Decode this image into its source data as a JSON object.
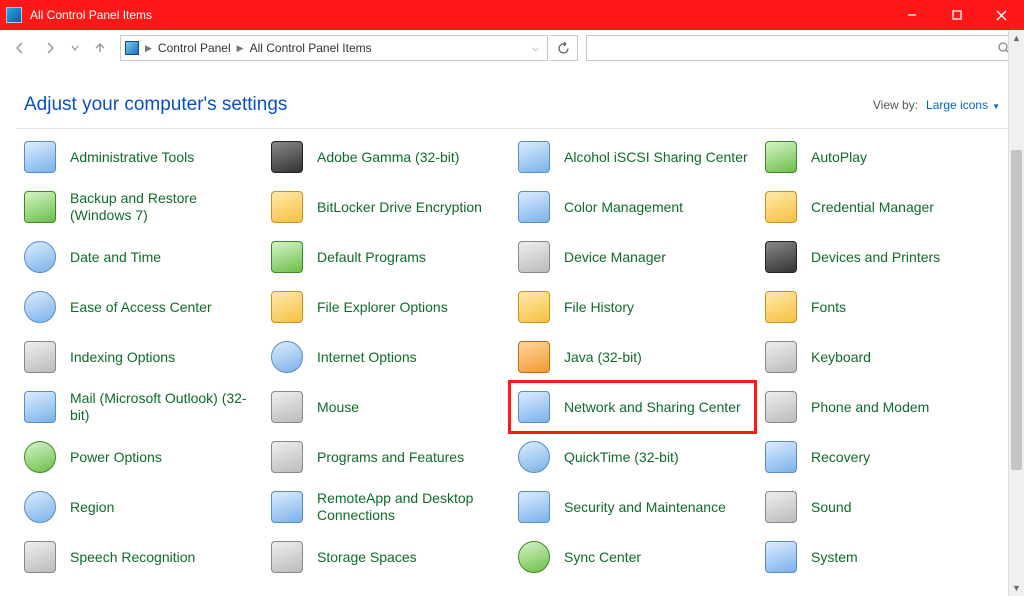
{
  "window": {
    "title": "All Control Panel Items"
  },
  "breadcrumb": {
    "root": "Control Panel",
    "current": "All Control Panel Items"
  },
  "search": {
    "placeholder": ""
  },
  "header": {
    "heading": "Adjust your computer's settings",
    "viewby_label": "View by:",
    "viewby_value": "Large icons"
  },
  "items": [
    {
      "label": "Administrative Tools",
      "icon": "admin-tools",
      "style": "blue"
    },
    {
      "label": "Adobe Gamma (32-bit)",
      "icon": "adobe-gamma",
      "style": "dark"
    },
    {
      "label": "Alcohol iSCSI Sharing Center",
      "icon": "alcohol-iscsi",
      "style": "blue"
    },
    {
      "label": "AutoPlay",
      "icon": "autoplay",
      "style": "green"
    },
    {
      "label": "Backup and Restore (Windows 7)",
      "icon": "backup-restore",
      "style": "green"
    },
    {
      "label": "BitLocker Drive Encryption",
      "icon": "bitlocker",
      "style": "gold"
    },
    {
      "label": "Color Management",
      "icon": "color-mgmt",
      "style": "blue"
    },
    {
      "label": "Credential Manager",
      "icon": "credential-mgr",
      "style": "gold"
    },
    {
      "label": "Date and Time",
      "icon": "date-time",
      "style": "blue"
    },
    {
      "label": "Default Programs",
      "icon": "default-programs",
      "style": "green"
    },
    {
      "label": "Device Manager",
      "icon": "device-manager",
      "style": "gray"
    },
    {
      "label": "Devices and Printers",
      "icon": "devices-printers",
      "style": "dark"
    },
    {
      "label": "Ease of Access Center",
      "icon": "ease-access",
      "style": "blue"
    },
    {
      "label": "File Explorer Options",
      "icon": "file-explorer-opts",
      "style": "gold"
    },
    {
      "label": "File History",
      "icon": "file-history",
      "style": "gold"
    },
    {
      "label": "Fonts",
      "icon": "fonts",
      "style": "gold"
    },
    {
      "label": "Indexing Options",
      "icon": "indexing",
      "style": "gray"
    },
    {
      "label": "Internet Options",
      "icon": "internet-opts",
      "style": "blue"
    },
    {
      "label": "Java (32-bit)",
      "icon": "java",
      "style": "orange"
    },
    {
      "label": "Keyboard",
      "icon": "keyboard",
      "style": "gray"
    },
    {
      "label": "Mail (Microsoft Outlook) (32-bit)",
      "icon": "mail",
      "style": "blue"
    },
    {
      "label": "Mouse",
      "icon": "mouse",
      "style": "gray"
    },
    {
      "label": "Network and Sharing Center",
      "icon": "network-sharing",
      "style": "blue",
      "highlight": true
    },
    {
      "label": "Phone and Modem",
      "icon": "phone-modem",
      "style": "gray"
    },
    {
      "label": "Power Options",
      "icon": "power-opts",
      "style": "green"
    },
    {
      "label": "Programs and Features",
      "icon": "programs-features",
      "style": "gray"
    },
    {
      "label": "QuickTime (32-bit)",
      "icon": "quicktime",
      "style": "blue"
    },
    {
      "label": "Recovery",
      "icon": "recovery",
      "style": "blue"
    },
    {
      "label": "Region",
      "icon": "region",
      "style": "blue"
    },
    {
      "label": "RemoteApp and Desktop Connections",
      "icon": "remoteapp",
      "style": "blue"
    },
    {
      "label": "Security and Maintenance",
      "icon": "security-maint",
      "style": "blue"
    },
    {
      "label": "Sound",
      "icon": "sound",
      "style": "gray"
    },
    {
      "label": "Speech Recognition",
      "icon": "speech",
      "style": "gray"
    },
    {
      "label": "Storage Spaces",
      "icon": "storage-spaces",
      "style": "gray"
    },
    {
      "label": "Sync Center",
      "icon": "sync-center",
      "style": "green"
    },
    {
      "label": "System",
      "icon": "system",
      "style": "blue"
    }
  ]
}
